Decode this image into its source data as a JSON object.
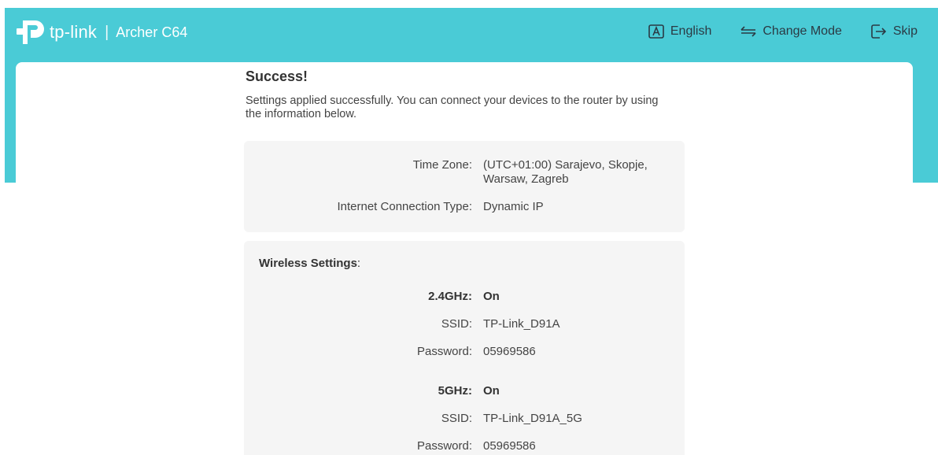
{
  "header": {
    "brand": "tp-link",
    "separator": "|",
    "model": "Archer C64",
    "actions": {
      "language": "English",
      "change_mode": "Change Mode",
      "skip": "Skip"
    }
  },
  "main": {
    "title": "Success!",
    "description": "Settings applied successfully. You can connect your devices to the router by using the information below.",
    "general": {
      "time_zone_label": "Time Zone:",
      "time_zone_value": "(UTC+01:00) Sarajevo, Skopje, Warsaw, Zagreb",
      "connection_label": "Internet Connection Type:",
      "connection_value": "Dynamic IP"
    },
    "wireless": {
      "section_label": "Wireless Settings",
      "section_suffix": ":",
      "bands": [
        {
          "band_label": "2.4GHz:",
          "band_status": "On",
          "ssid_label": "SSID:",
          "ssid_value": "TP-Link_D91A",
          "password_label": "Password:",
          "password_value": "05969586"
        },
        {
          "band_label": "5GHz:",
          "band_status": "On",
          "ssid_label": "SSID:",
          "ssid_value": "TP-Link_D91A_5G",
          "password_label": "Password:",
          "password_value": "05969586"
        }
      ]
    }
  },
  "colors": {
    "header_bg": "#4acbd6",
    "card_bg": "#ffffff",
    "panel_bg": "#f5f5f5"
  },
  "icons": {
    "logo": "tp-link-logo-icon",
    "language": "language-a-icon",
    "change_mode": "swap-arrows-icon",
    "skip": "exit-arrow-icon"
  }
}
